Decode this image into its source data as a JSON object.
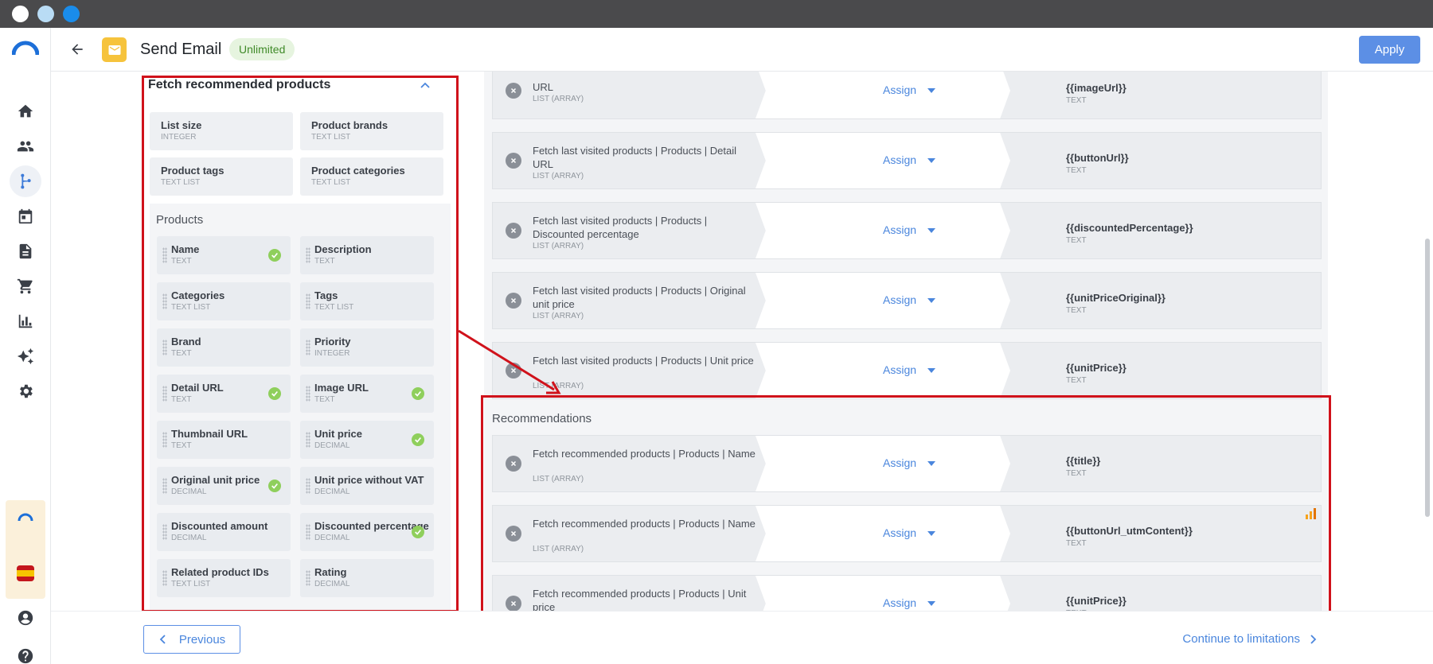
{
  "header": {
    "title": "Send Email",
    "badge": "Unlimited",
    "apply_label": "Apply"
  },
  "sidebar": {
    "icons": [
      "logo-icon",
      "home-icon",
      "people-icon",
      "flow-icon",
      "calendar-icon",
      "document-icon",
      "cart-icon",
      "chart-icon",
      "sparkle-icon",
      "gear-icon",
      "user-icon",
      "help-icon"
    ]
  },
  "left_panel": {
    "title": "Fetch recommended products",
    "params": [
      {
        "name": "List size",
        "type": "INTEGER"
      },
      {
        "name": "Product brands",
        "type": "TEXT LIST"
      },
      {
        "name": "Product tags",
        "type": "TEXT LIST"
      },
      {
        "name": "Product categories",
        "type": "TEXT LIST"
      }
    ],
    "products_label": "Products",
    "products": [
      {
        "name": "Name",
        "type": "TEXT",
        "checked": true
      },
      {
        "name": "Description",
        "type": "TEXT",
        "checked": false
      },
      {
        "name": "Categories",
        "type": "TEXT LIST",
        "checked": false
      },
      {
        "name": "Tags",
        "type": "TEXT LIST",
        "checked": false
      },
      {
        "name": "Brand",
        "type": "TEXT",
        "checked": false
      },
      {
        "name": "Priority",
        "type": "INTEGER",
        "checked": false
      },
      {
        "name": "Detail URL",
        "type": "TEXT",
        "checked": true
      },
      {
        "name": "Image URL",
        "type": "TEXT",
        "checked": true
      },
      {
        "name": "Thumbnail URL",
        "type": "TEXT",
        "checked": false
      },
      {
        "name": "Unit price",
        "type": "DECIMAL",
        "checked": true
      },
      {
        "name": "Original unit price",
        "type": "DECIMAL",
        "checked": true
      },
      {
        "name": "Unit price without VAT",
        "type": "DECIMAL",
        "checked": false
      },
      {
        "name": "Discounted amount",
        "type": "DECIMAL",
        "checked": false
      },
      {
        "name": "Discounted percentage",
        "type": "DECIMAL",
        "checked": true
      },
      {
        "name": "Related product IDs",
        "type": "TEXT LIST",
        "checked": false
      },
      {
        "name": "Rating",
        "type": "DECIMAL",
        "checked": false
      }
    ]
  },
  "mappings": {
    "assign_label": "Assign",
    "last_visited": [
      {
        "source": "URL",
        "source_type": "LIST (ARRAY)",
        "target": "{{imageUrl}}",
        "target_type": "TEXT"
      },
      {
        "source": "Fetch last visited products | Products | Detail URL",
        "source_type": "LIST (ARRAY)",
        "target": "{{buttonUrl}}",
        "target_type": "TEXT"
      },
      {
        "source": "Fetch last visited products | Products | Discounted percentage",
        "source_type": "LIST (ARRAY)",
        "target": "{{discountedPercentage}}",
        "target_type": "TEXT"
      },
      {
        "source": "Fetch last visited products | Products | Original unit price",
        "source_type": "LIST (ARRAY)",
        "target": "{{unitPriceOriginal}}",
        "target_type": "TEXT"
      },
      {
        "source": "Fetch last visited products | Products | Unit price",
        "source_type": "LIST (ARRAY)",
        "target": "{{unitPrice}}",
        "target_type": "TEXT"
      }
    ],
    "recommendations_label": "Recommendations",
    "recommendations": [
      {
        "source": "Fetch recommended products | Products | Name",
        "source_type": "LIST (ARRAY)",
        "target": "{{title}}",
        "target_type": "TEXT"
      },
      {
        "source": "Fetch recommended products | Products | Name",
        "source_type": "LIST (ARRAY)",
        "target": "{{buttonUrl_utmContent}}",
        "target_type": "TEXT"
      },
      {
        "source": "Fetch recommended products | Products | Unit price",
        "source_type": "LIST (ARRAY)",
        "target": "{{unitPrice}}",
        "target_type": "TEXT"
      }
    ]
  },
  "footer": {
    "previous_label": "Previous",
    "next_label": "Continue to limitations"
  },
  "colors": {
    "accent": "#4a86dd",
    "highlight": "#d0121b",
    "check": "#8fcf5c",
    "badge_bg": "#e6f4df"
  }
}
